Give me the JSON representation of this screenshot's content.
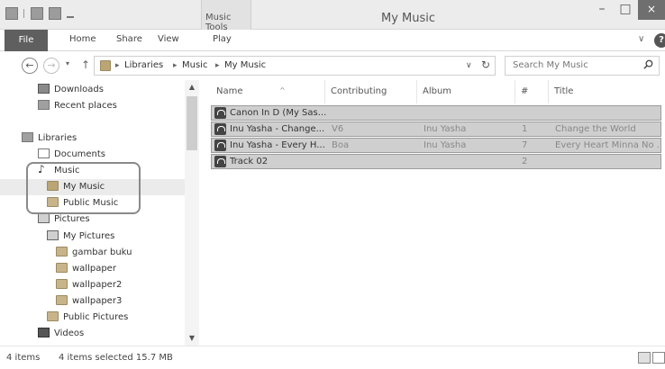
{
  "window": {
    "title": "My Music",
    "contextual_tab": "Music Tools",
    "controls": {
      "minimize": "–",
      "maximize": "□",
      "close": "×"
    }
  },
  "ribbon": {
    "tabs": [
      "File",
      "Home",
      "Share",
      "View",
      "Play"
    ],
    "chevron": "∨",
    "help": "?"
  },
  "address": {
    "back": "←",
    "forward": "→",
    "recent": "▾",
    "up": "↑",
    "crumbs": [
      "Libraries",
      "Music",
      "My Music"
    ],
    "sep": "▸",
    "dropdown": "∨",
    "refresh": "↻",
    "search_placeholder": "Search My Music"
  },
  "nav": {
    "items": [
      {
        "label": "Downloads",
        "icon": "downloads-icon"
      },
      {
        "label": "Recent places",
        "icon": "recent-places-icon"
      },
      {
        "label": "Libraries",
        "icon": "libraries-icon"
      },
      {
        "label": "Documents",
        "icon": "documents-icon"
      },
      {
        "label": "Music",
        "icon": "music-icon"
      },
      {
        "label": "My Music",
        "icon": "folder-icon",
        "selected": true
      },
      {
        "label": "Public Music",
        "icon": "folder-icon"
      },
      {
        "label": "Pictures",
        "icon": "pictures-icon"
      },
      {
        "label": "My Pictures",
        "icon": "pictures-icon"
      },
      {
        "label": "gambar buku",
        "icon": "folder-icon"
      },
      {
        "label": "wallpaper",
        "icon": "folder-icon"
      },
      {
        "label": "wallpaper2",
        "icon": "folder-icon"
      },
      {
        "label": "wallpaper3",
        "icon": "folder-icon"
      },
      {
        "label": "Public Pictures",
        "icon": "folder-icon"
      },
      {
        "label": "Videos",
        "icon": "videos-icon"
      }
    ]
  },
  "table": {
    "columns": [
      "Name",
      "Contributing artists",
      "Album",
      "#",
      "Title"
    ],
    "sort_indicator": "^",
    "rows": [
      {
        "name": "Canon In D (My Sas...",
        "artist": "",
        "album": "",
        "num": "",
        "title": ""
      },
      {
        "name": "Inu Yasha - Change...",
        "artist": "V6",
        "album": "Inu Yasha",
        "num": "1",
        "title": "Change the World"
      },
      {
        "name": "Inu Yasha - Every H...",
        "artist": "Boa",
        "album": "Inu Yasha",
        "num": "7",
        "title": "Every Heart Minna No ..."
      },
      {
        "name": "Track 02",
        "artist": "",
        "album": "",
        "num": "2",
        "title": ""
      }
    ]
  },
  "status": {
    "count": "4 items",
    "selection": "4 items selected  15.7 MB"
  },
  "scroll": {
    "up": "▲",
    "down": "▼"
  }
}
